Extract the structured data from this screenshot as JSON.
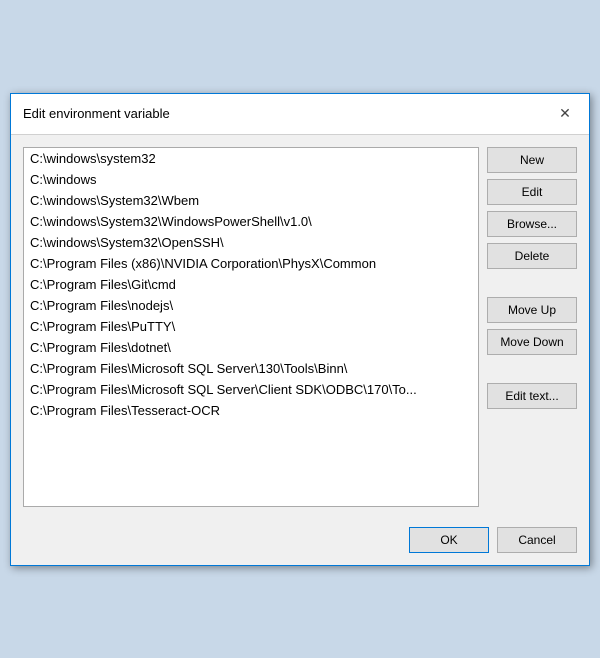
{
  "dialog": {
    "title": "Edit environment variable",
    "close_label": "✕"
  },
  "list": {
    "items": [
      "C:\\windows\\system32",
      "C:\\windows",
      "C:\\windows\\System32\\Wbem",
      "C:\\windows\\System32\\WindowsPowerShell\\v1.0\\",
      "C:\\windows\\System32\\OpenSSH\\",
      "C:\\Program Files (x86)\\NVIDIA Corporation\\PhysX\\Common",
      "C:\\Program Files\\Git\\cmd",
      "C:\\Program Files\\nodejs\\",
      "C:\\Program Files\\PuTTY\\",
      "C:\\Program Files\\dotnet\\",
      "C:\\Program Files\\Microsoft SQL Server\\130\\Tools\\Binn\\",
      "C:\\Program Files\\Microsoft SQL Server\\Client SDK\\ODBC\\170\\To...",
      "C:\\Program Files\\Tesseract-OCR"
    ]
  },
  "buttons": {
    "new_label": "New",
    "edit_label": "Edit",
    "browse_label": "Browse...",
    "delete_label": "Delete",
    "move_up_label": "Move Up",
    "move_down_label": "Move Down",
    "edit_text_label": "Edit text..."
  },
  "footer": {
    "ok_label": "OK",
    "cancel_label": "Cancel"
  }
}
